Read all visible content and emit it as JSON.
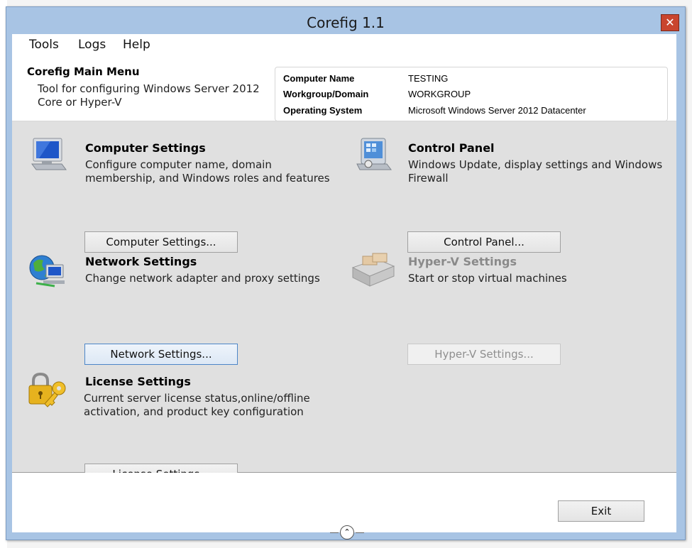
{
  "window": {
    "title": "Corefig 1.1",
    "close_glyph": "✕"
  },
  "menu": [
    {
      "label": "Tools"
    },
    {
      "label": "Logs"
    },
    {
      "label": "Help"
    }
  ],
  "header": {
    "title": "Corefig Main Menu",
    "description": "Tool for configuring Windows Server 2012 Core or Hyper-V"
  },
  "system_info": [
    {
      "key": "Computer Name",
      "value": "TESTING"
    },
    {
      "key": "Workgroup/Domain",
      "value": "WORKGROUP"
    },
    {
      "key": "Operating System",
      "value": "Microsoft Windows Server 2012 Datacenter"
    }
  ],
  "sections": {
    "computer": {
      "title": "Computer Settings",
      "description": "Configure computer name, domain membership, and Windows roles and features",
      "button": "Computer Settings...",
      "icon": "monitor-icon"
    },
    "control_panel": {
      "title": "Control Panel",
      "description": "Windows Update, display settings and Windows Firewall",
      "button": "Control Panel...",
      "icon": "control-panel-icon"
    },
    "network": {
      "title": "Network Settings",
      "description": "Change network adapter and proxy settings",
      "button": "Network Settings...",
      "icon": "network-globe-icon"
    },
    "hyperv": {
      "title": "Hyper-V Settings",
      "description": "Start or stop virtual machines",
      "button": "Hyper-V Settings...",
      "icon": "server-rack-icon"
    },
    "license": {
      "title": "License Settings",
      "description": "Current server license status,online/offline activation, and product key configuration",
      "button": "License Settings...",
      "icon": "lock-key-icon"
    }
  },
  "footer": {
    "exit_label": "Exit",
    "collapse_glyph": "⌃"
  },
  "colors": {
    "titlebar": "#a8c4e4",
    "close_button": "#c9452e",
    "panel_bg": "#e0e0e0",
    "focus_border": "#4c86c8"
  }
}
